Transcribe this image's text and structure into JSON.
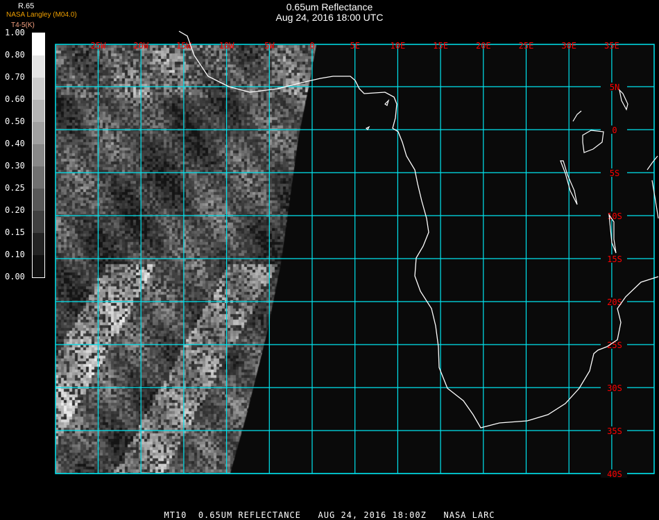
{
  "header": {
    "title": "0.65um Reflectance",
    "subtitle": "Aug 24, 2016 18:00 UTC",
    "product": "R.65",
    "organization": "NASA Langley (M04.0)",
    "unit_label": "T4-5(K)"
  },
  "colorbar": {
    "labels": [
      "1.00",
      "0.80",
      "0.70",
      "0.60",
      "0.50",
      "0.40",
      "0.30",
      "0.25",
      "0.20",
      "0.15",
      "0.10",
      "0.00"
    ],
    "grays": [
      "#ffffff",
      "#e4e4e4",
      "#cccccc",
      "#b4b4b4",
      "#a0a0a0",
      "#888888",
      "#707070",
      "#585858",
      "#404040",
      "#242424",
      "#101010"
    ]
  },
  "map": {
    "lon_labels": [
      "25W",
      "20W",
      "15W",
      "10W",
      "5W",
      "0",
      "5E",
      "10E",
      "15E",
      "20E",
      "25E",
      "30E",
      "35E"
    ],
    "lat_labels": [
      "5N",
      "0",
      "5S",
      "10S",
      "15S",
      "20S",
      "25S",
      "30S",
      "35S",
      "40S"
    ],
    "grid_color": "#00e5f0",
    "label_color": "#ff0000",
    "coast_color": "#ffffff"
  },
  "footer": {
    "text": "MT10  0.65UM REFLECTANCE   AUG 24, 2016 18:00Z   NASA LARC"
  }
}
